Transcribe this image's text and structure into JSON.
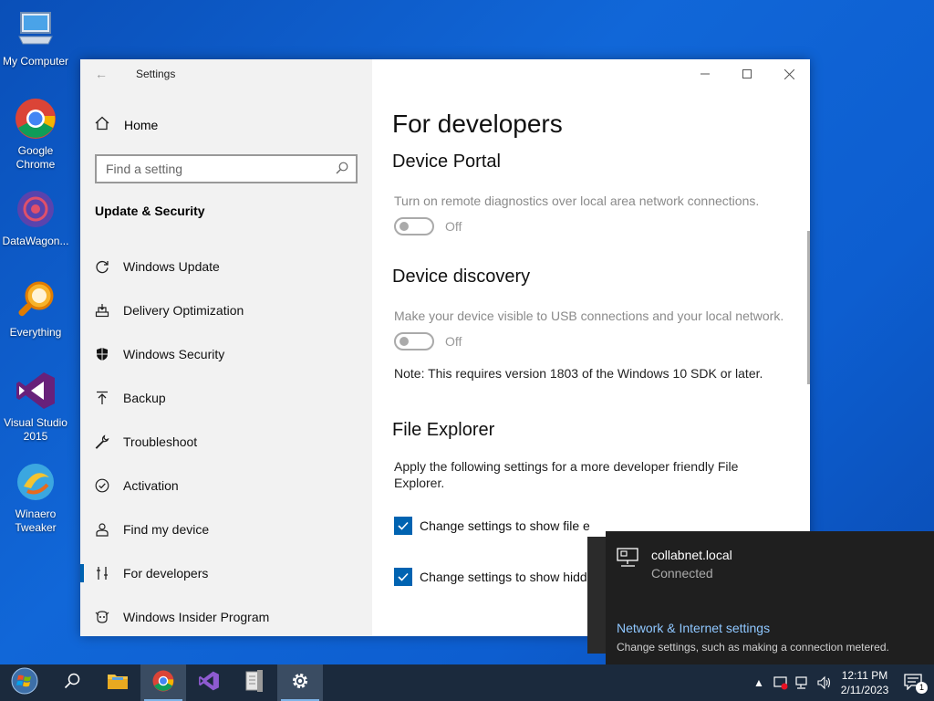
{
  "desktop": {
    "icons": [
      {
        "label": "My Computer"
      },
      {
        "label": "Google Chrome"
      },
      {
        "label": "DataWagon..."
      },
      {
        "label": "Everything"
      },
      {
        "label": "Visual Studio 2015"
      },
      {
        "label": "Winaero Tweaker"
      }
    ]
  },
  "settings": {
    "window_title": "Settings",
    "sidebar": {
      "home": "Home",
      "search_placeholder": "Find a setting",
      "section": "Update & Security",
      "items": [
        {
          "label": "Windows Update",
          "icon": "refresh-icon"
        },
        {
          "label": "Delivery Optimization",
          "icon": "delivery-icon"
        },
        {
          "label": "Windows Security",
          "icon": "shield-icon"
        },
        {
          "label": "Backup",
          "icon": "backup-icon"
        },
        {
          "label": "Troubleshoot",
          "icon": "wrench-icon"
        },
        {
          "label": "Activation",
          "icon": "check-circle-icon"
        },
        {
          "label": "Find my device",
          "icon": "person-pin-icon"
        },
        {
          "label": "For developers",
          "icon": "developer-tools-icon",
          "active": true
        },
        {
          "label": "Windows Insider Program",
          "icon": "insider-icon"
        }
      ]
    },
    "content": {
      "title": "For developers",
      "device_portal": {
        "heading": "Device Portal",
        "description": "Turn on remote diagnostics over local area network connections.",
        "toggle_state": "Off"
      },
      "device_discovery": {
        "heading": "Device discovery",
        "description": "Make your device visible to USB connections and your local network.",
        "toggle_state": "Off",
        "note": "Note: This requires version 1803 of the Windows 10 SDK or later."
      },
      "file_explorer": {
        "heading": "File Explorer",
        "description": "Apply the following settings for a more developer friendly File Explorer.",
        "option1": "Change settings to show file e",
        "option2": "Change settings to show hidd"
      }
    }
  },
  "network_flyout": {
    "network_name": "collabnet.local",
    "status": "Connected",
    "settings_link": "Network & Internet settings",
    "settings_sub": "Change settings, such as making a connection metered."
  },
  "taskbar": {
    "time": "12:11 PM",
    "date": "2/11/2023",
    "notification_count": "1"
  },
  "colors": {
    "accent": "#0063b1",
    "desktop": "#1167d8",
    "taskbar": "#1b2a3d"
  }
}
